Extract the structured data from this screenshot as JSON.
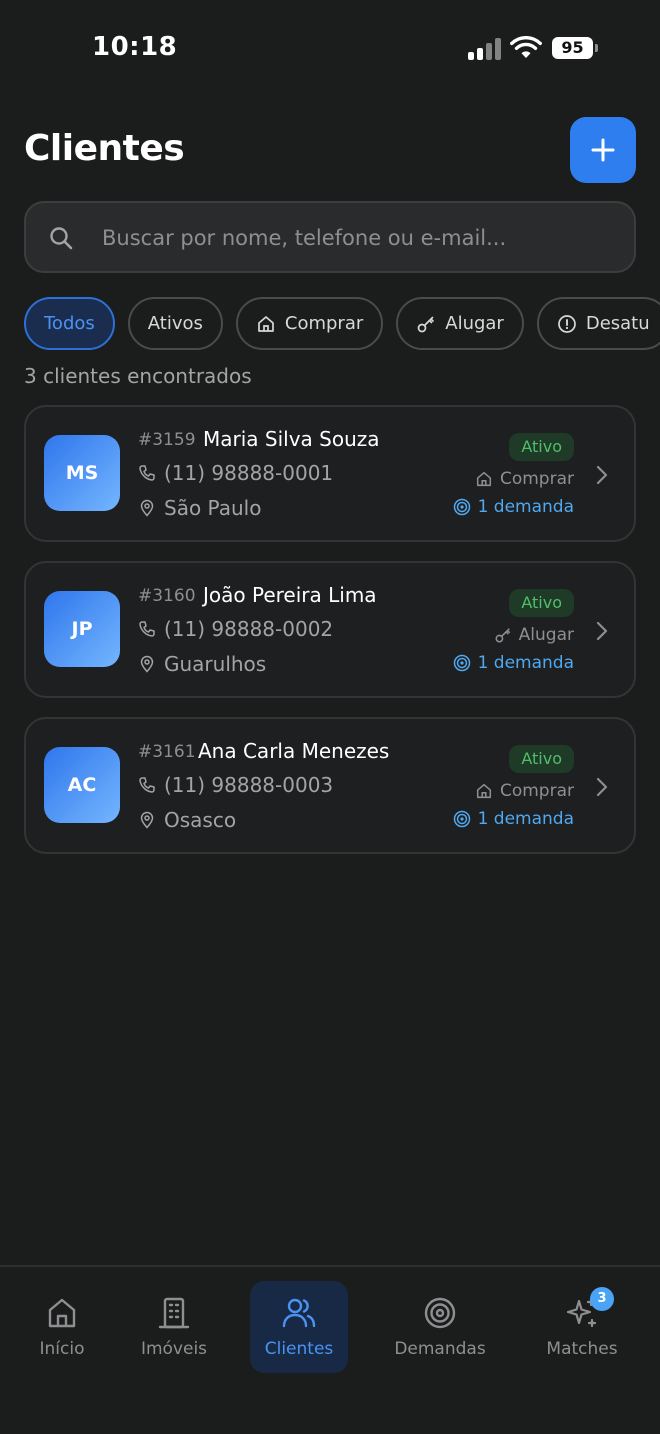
{
  "status_bar": {
    "time": "10:18",
    "battery": "95"
  },
  "header": {
    "title": "Clientes"
  },
  "search": {
    "placeholder": "Buscar por nome, telefone ou e-mail..."
  },
  "filters": [
    {
      "label": "Todos",
      "icon": ""
    },
    {
      "label": "Ativos",
      "icon": ""
    },
    {
      "label": "Comprar",
      "icon": "house-icon"
    },
    {
      "label": "Alugar",
      "icon": "key-icon"
    },
    {
      "label": "Desatu",
      "icon": "alert-circle-icon"
    }
  ],
  "result_count": "3 clientes encontrados",
  "clients": [
    {
      "initials": "MS",
      "id": "#3159",
      "name": "Maria Silva Souza",
      "phone": "(11) 98888-0001",
      "city": "São Paulo",
      "status": "Ativo",
      "intent": "Comprar",
      "demands": "1 demanda"
    },
    {
      "initials": "JP",
      "id": "#3160",
      "name": "João Pereira Lima",
      "phone": "(11) 98888-0002",
      "city": "Guarulhos",
      "status": "Ativo",
      "intent": "Alugar",
      "demands": "1 demanda"
    },
    {
      "initials": "AC",
      "id": "#3161",
      "name": "Ana Carla Menezes",
      "phone": "(11) 98888-0003",
      "city": "Osasco",
      "status": "Ativo",
      "intent": "Comprar",
      "demands": "1 demanda"
    }
  ],
  "nav": {
    "items": [
      {
        "label": "Início",
        "icon": "home-icon"
      },
      {
        "label": "Imóveis",
        "icon": "building-icon"
      },
      {
        "label": "Clientes",
        "icon": "users-icon"
      },
      {
        "label": "Demandas",
        "icon": "target-icon"
      },
      {
        "label": "Matches",
        "icon": "sparkles-icon"
      }
    ],
    "matches_badge": "3"
  },
  "colors": {
    "accent": "#2f7ef0",
    "active_status": "#4fbf6b",
    "demand": "#4fa8f0"
  }
}
